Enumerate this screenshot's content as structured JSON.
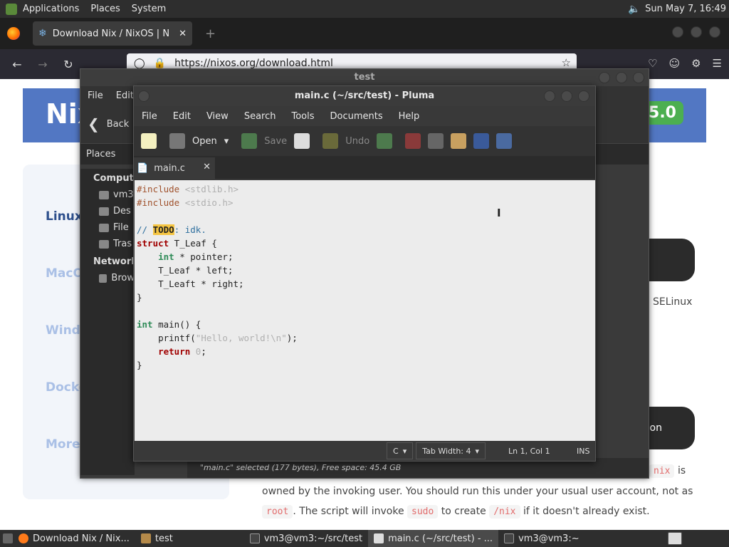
{
  "topbar": {
    "menus": [
      "Applications",
      "Places",
      "System"
    ],
    "clock": "Sun May  7, 16:49"
  },
  "firefox": {
    "tab_title": "Download Nix / NixOS | N",
    "url": "https://nixos.org/download.html"
  },
  "webpage": {
    "brand": "Nix",
    "version_badge": "5.0",
    "side_links": [
      "Linux",
      "MacO",
      "Windo",
      "Docke",
      "More"
    ],
    "selinux": "SELinux",
    "on_button": "on",
    "prose_line1_end": "is",
    "prose_line2": "owned by the invoking user. You should run this under your usual user account, not as",
    "prose_line3_a": ". The script will invoke",
    "prose_line3_b": "to create",
    "prose_line3_c": "if it doesn't already exist.",
    "code_nix": "nix",
    "code_root": "root",
    "code_sudo": "sudo",
    "code_slashnix": "/nix"
  },
  "filemanager": {
    "title": "test",
    "menus": [
      "File",
      "Edit"
    ],
    "back": "Back",
    "places_header": "Places",
    "sections": {
      "computer": "Compute",
      "network": "Network"
    },
    "items": [
      "vm3",
      "Des",
      "File",
      "Tras"
    ],
    "network_items": [
      "Brow"
    ],
    "status": "\"main.c\" selected (177 bytes), Free space: 45.4 GB"
  },
  "pluma": {
    "title": "main.c (~/src/test) - Pluma",
    "menus": [
      "File",
      "Edit",
      "View",
      "Search",
      "Tools",
      "Documents",
      "Help"
    ],
    "toolbar": {
      "open": "Open",
      "save": "Save",
      "undo": "Undo"
    },
    "tab": "main.c",
    "code": {
      "l1a": "#include ",
      "l1b": "<stdlib.h>",
      "l2a": "#include ",
      "l2b": "<stdio.h>",
      "l4a": "// ",
      "l4todo": "TODO",
      "l4b": ": idk.",
      "l5a": "struct",
      "l5b": " T_Leaf {",
      "l6a": "    ",
      "l6kw": "int",
      "l6b": " * pointer;",
      "l7": "    T_Leaf * left;",
      "l8": "    T_Leaft * right;",
      "l9": "}",
      "l11kw": "int",
      "l11b": " main() {",
      "l12a": "    printf(",
      "l12s": "\"Hello, world!\\n\"",
      "l12b": ");",
      "l13a": "    ",
      "l13kw": "return",
      "l13n": " 0",
      "l13b": ";",
      "l14": "}"
    },
    "status": {
      "lang": "C",
      "tabwidth": "Tab Width:  4",
      "pos": "Ln 1, Col 1",
      "mode": "INS"
    }
  },
  "taskbar": {
    "items": [
      "Download Nix / Nix...",
      "test",
      "vm3@vm3:~/src/test",
      "main.c (~/src/test) - ...",
      "vm3@vm3:~"
    ]
  },
  "colors": {
    "accent_blue": "#5277c3",
    "badge_green": "#4caf50"
  }
}
